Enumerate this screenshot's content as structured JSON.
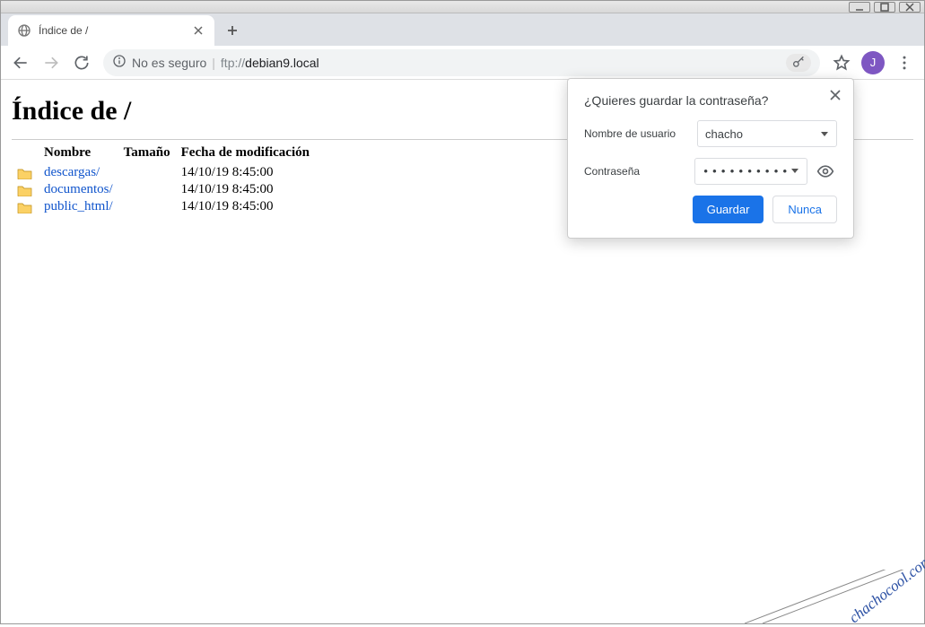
{
  "window": {
    "tab_title": "Índice de /"
  },
  "omnibox": {
    "not_secure": "No es seguro",
    "protocol": "ftp://",
    "host": "debian9.local"
  },
  "avatar": {
    "initial": "J"
  },
  "page": {
    "title": "Índice de /",
    "columns": {
      "name": "Nombre",
      "size": "Tamaño",
      "modified": "Fecha de modificación"
    },
    "rows": [
      {
        "name": "descargas/",
        "size": "",
        "modified": "14/10/19 8:45:00"
      },
      {
        "name": "documentos/",
        "size": "",
        "modified": "14/10/19 8:45:00"
      },
      {
        "name": "public_html/",
        "size": "",
        "modified": "14/10/19 8:45:00"
      }
    ]
  },
  "save_pw": {
    "title": "¿Quieres guardar la contraseña?",
    "username_label": "Nombre de usuario",
    "username_value": "chacho",
    "password_label": "Contraseña",
    "password_mask": "••••••••••",
    "save_label": "Guardar",
    "never_label": "Nunca"
  },
  "watermark": "chachocool.com"
}
